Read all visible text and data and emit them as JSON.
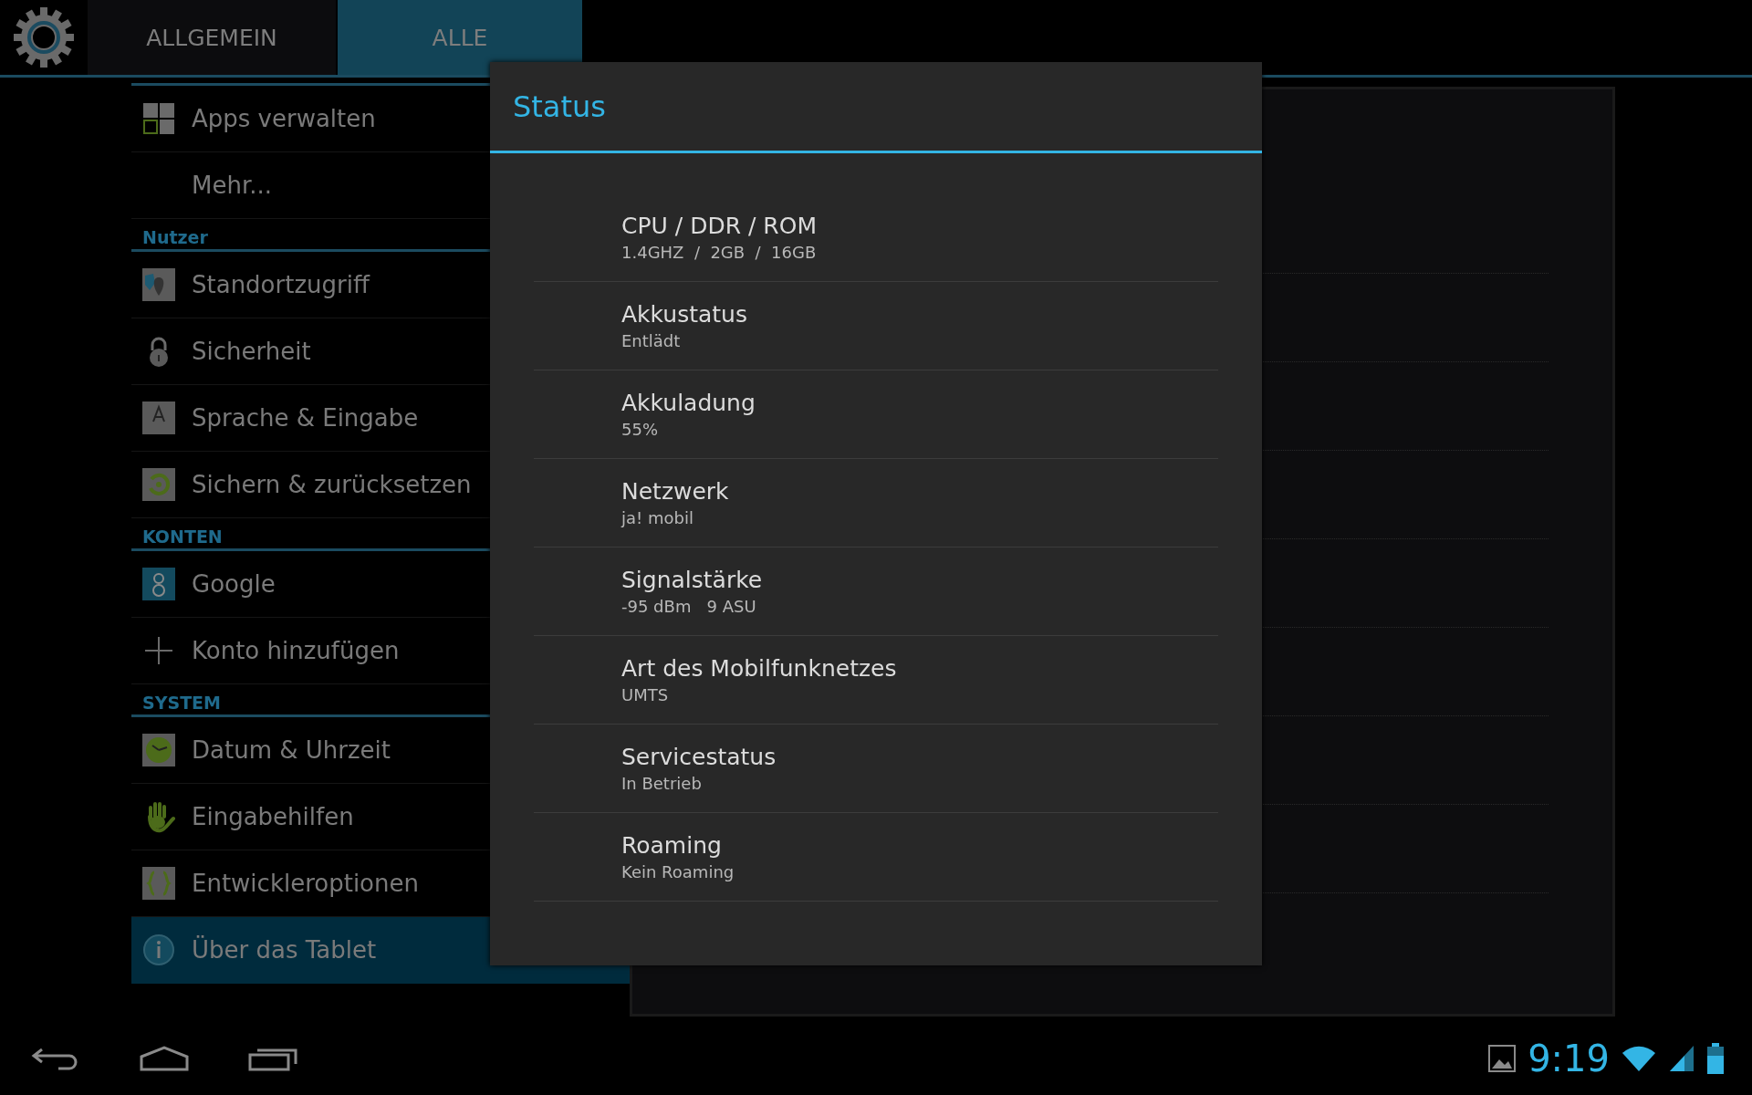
{
  "tabs": [
    {
      "label": "ALLGEMEIN",
      "selected": false
    },
    {
      "label": "ALLE",
      "selected": true
    }
  ],
  "sidebar": [
    {
      "items": [
        {
          "label": "Apps verwalten",
          "selected": false
        },
        {
          "label": "Mehr...",
          "selected": false
        }
      ]
    },
    {
      "header": "Nutzer",
      "items": [
        {
          "label": "Standortzugriff",
          "selected": false
        },
        {
          "label": "Sicherheit",
          "selected": false
        },
        {
          "label": "Sprache & Eingabe",
          "selected": false
        },
        {
          "label": "Sichern & zurücksetzen",
          "selected": false
        }
      ]
    },
    {
      "header": "KONTEN",
      "items": [
        {
          "label": "Google",
          "selected": false
        },
        {
          "label": "Konto hinzufügen",
          "selected": false
        }
      ]
    },
    {
      "header": "SYSTEM",
      "items": [
        {
          "label": "Datum & Uhrzeit",
          "selected": false
        },
        {
          "label": "Eingabehilfen",
          "selected": false
        },
        {
          "label": "Entwickleroptionen",
          "selected": false
        },
        {
          "label": "Über das Tablet",
          "selected": true
        }
      ]
    }
  ],
  "dialog": {
    "title": "Status",
    "rows": [
      {
        "title": "CPU / DDR / ROM",
        "value": "1.4GHZ  /  2GB  /  16GB"
      },
      {
        "title": "Akkustatus",
        "value": "Entlädt"
      },
      {
        "title": "Akkuladung",
        "value": "55%"
      },
      {
        "title": "Netzwerk",
        "value": "ja! mobil"
      },
      {
        "title": "Signalstärke",
        "value": "-95 dBm   9 ASU"
      },
      {
        "title": "Art des Mobilfunknetzes",
        "value": "UMTS"
      },
      {
        "title": "Servicestatus",
        "value": "In Betrieb"
      },
      {
        "title": "Roaming",
        "value": "Kein Roaming"
      }
    ]
  },
  "status_bar": {
    "time": "9:19"
  }
}
